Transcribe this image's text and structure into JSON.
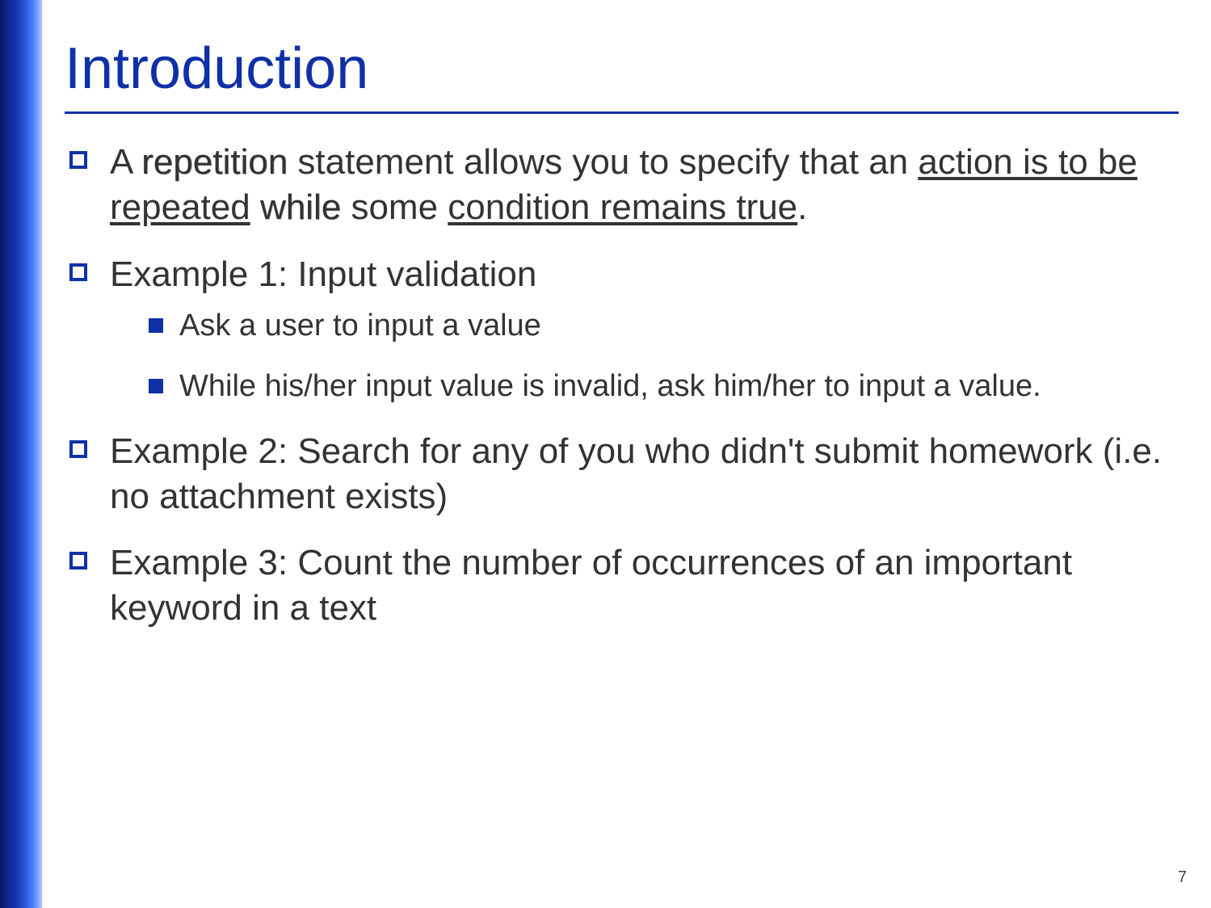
{
  "title": "Introduction",
  "bullets": {
    "b1": {
      "p1": "A ",
      "repetition": "repetition",
      "p2": " statement allows you to specify that an ",
      "u1": "action is to be repeated",
      "sp": " ",
      "while": "while",
      "p3": " some ",
      "u2": "condition remains true",
      "p4": "."
    },
    "b2": "Example 1: Input validation",
    "b2sub": {
      "s1": "Ask a user to input a value",
      "s2": "While his/her input value is invalid, ask him/her to input a value."
    },
    "b3": "Example 2: Search for any of you who didn't submit homework (i.e. no attachment exists)",
    "b4": "Example 3: Count the number of occurrences of an important keyword in a text"
  },
  "page_number": "7"
}
